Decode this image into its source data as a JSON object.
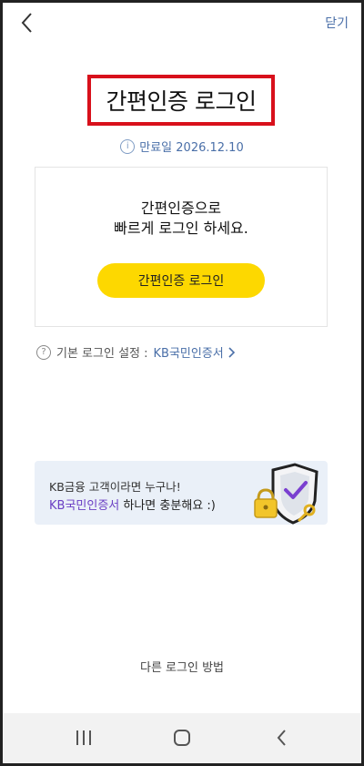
{
  "header": {
    "back_icon": "chevron-left-icon",
    "close_label": "닫기"
  },
  "title": "간편인증 로그인",
  "expiry": {
    "icon": "info-icon",
    "text": "만료일 2026.12.10"
  },
  "card": {
    "line1": "간편인증으로",
    "line2": "빠르게 로그인 하세요.",
    "button_label": "간편인증 로그인",
    "button_color": "#fdd800"
  },
  "basic_login": {
    "icon": "question-icon",
    "label": "기본 로그인 설정 :",
    "link_label": "KB국민인증서",
    "chevron": "chevron-right-icon"
  },
  "banner": {
    "line1": "KB금융 고객이라면 누구나!",
    "line2_accent": "KB국민인증서",
    "line2_rest": " 하나면 충분해요 :)",
    "accent_color": "#6b3fc4",
    "illustration": "shield-lock-key-icon"
  },
  "other_methods": "다른 로그인 방법",
  "navbar": {
    "items": [
      "recent-apps-icon",
      "home-icon",
      "back-icon"
    ]
  },
  "colors": {
    "highlight_border": "#d8101b",
    "link": "#4a6fa8",
    "banner_bg": "#eaf0f8"
  }
}
